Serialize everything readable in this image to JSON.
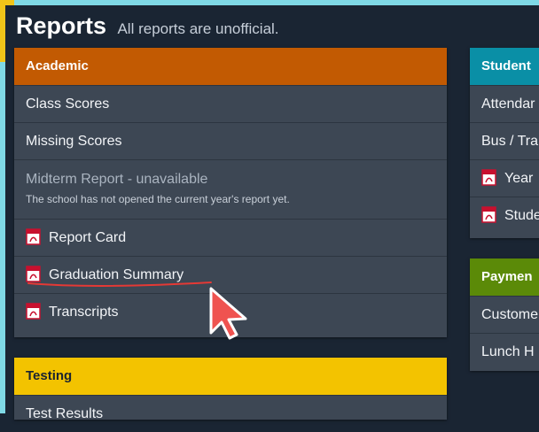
{
  "header": {
    "title": "Reports",
    "subtitle": "All reports are unofficial."
  },
  "colors": {
    "academic": "#c25a02",
    "testing": "#f3c300",
    "student": "#0a8fa6",
    "payments": "#5b8a08",
    "panel": "#3d4754",
    "background": "#1a2533"
  },
  "academic": {
    "title": "Academic",
    "items": {
      "class_scores": "Class Scores",
      "missing_scores": "Missing Scores",
      "midterm": "Midterm Report - unavailable",
      "midterm_note": "The school has not opened the current year's report yet.",
      "report_card": "Report Card",
      "graduation_summary": "Graduation Summary",
      "transcripts": "Transcripts"
    }
  },
  "testing": {
    "title": "Testing",
    "items": {
      "test_results": "Test Results"
    }
  },
  "student": {
    "title": "Student",
    "items": {
      "attendance": "Attendar",
      "bus": "Bus / Tra",
      "year": "Year",
      "student": "Stude"
    }
  },
  "payments": {
    "title": "Paymen",
    "items": {
      "customer": "Custome",
      "lunch": "Lunch H"
    }
  },
  "icons": {
    "pdf": "pdf-file-icon",
    "cursor": "mouse-pointer-icon"
  }
}
